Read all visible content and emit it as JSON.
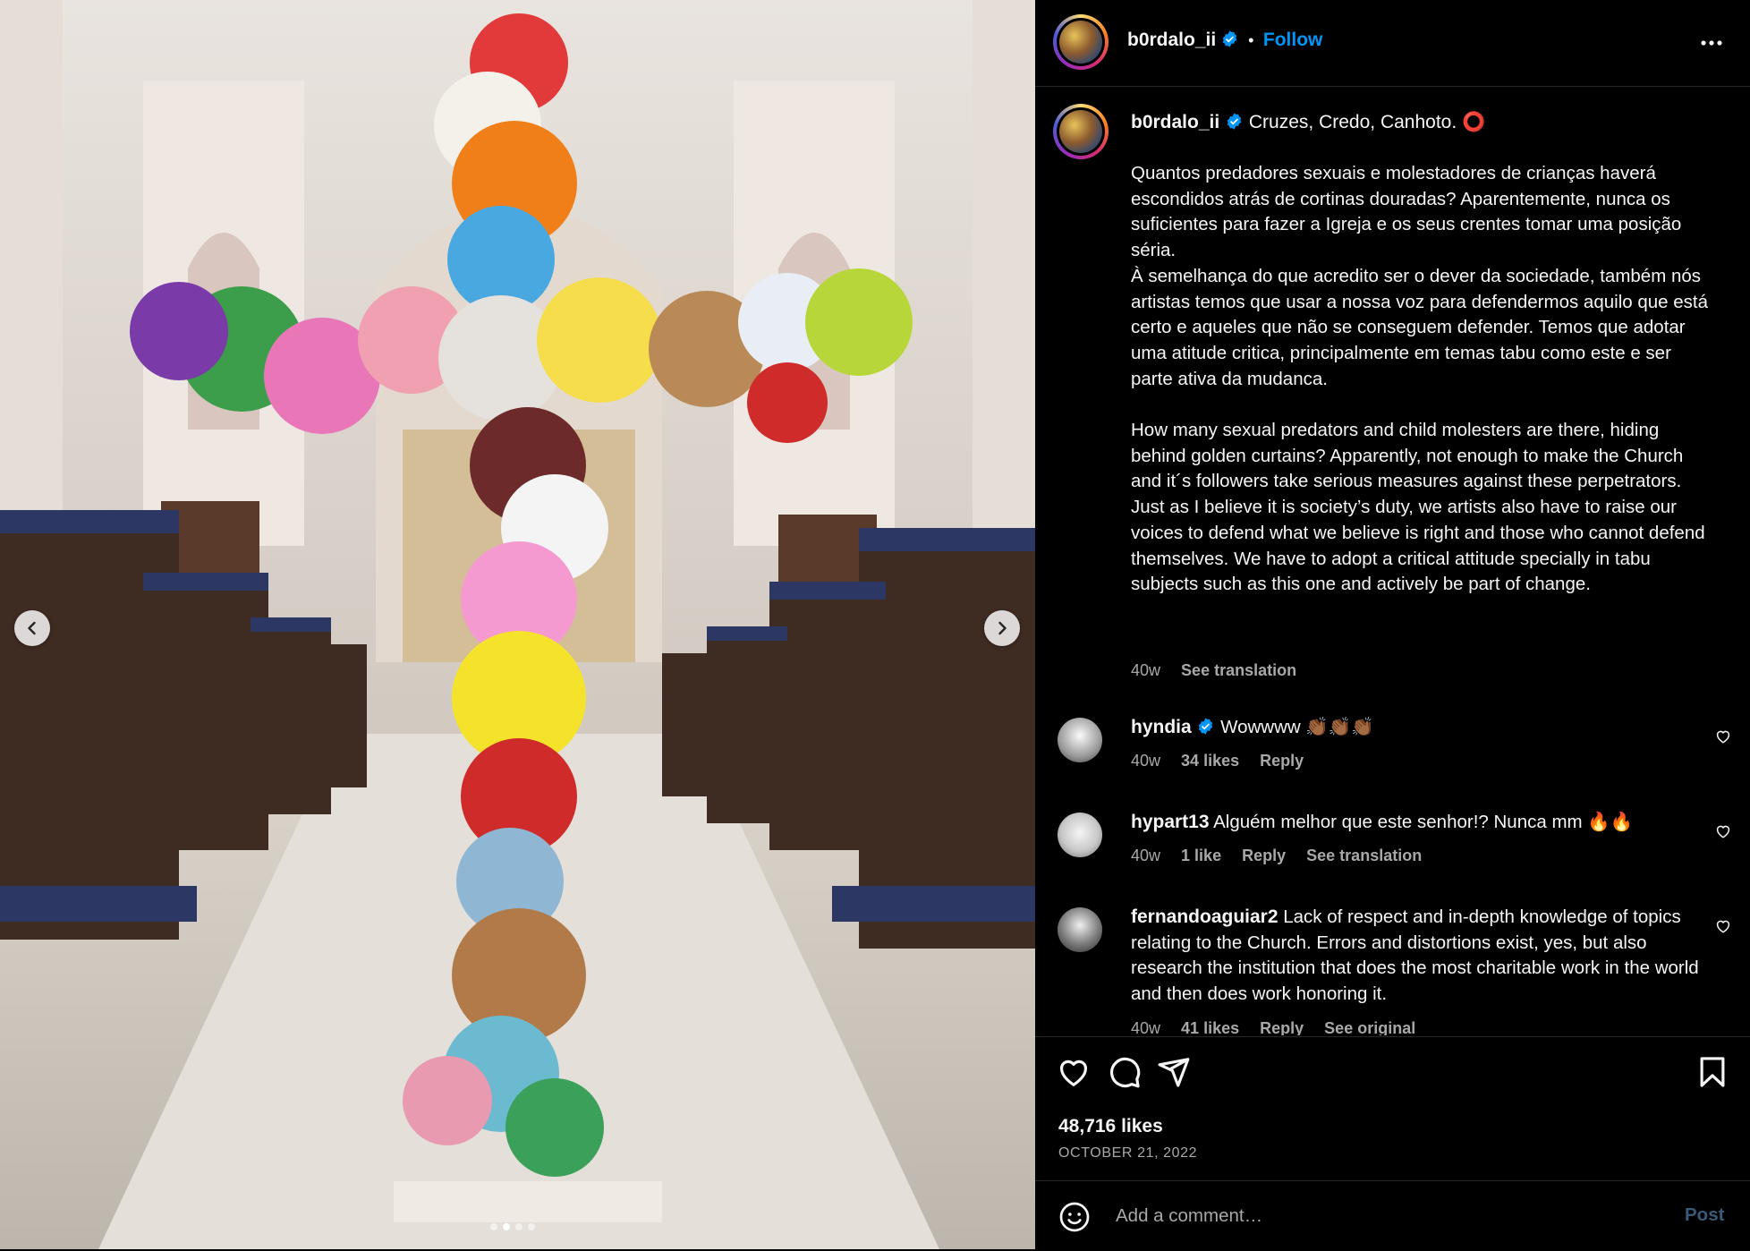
{
  "post": {
    "username": "b0rdalo_ii",
    "follow_label": "Follow",
    "separator": "•",
    "caption_title": "Cruzes, Credo, Canhoto. ⭕",
    "caption_body": "Quantos predadores sexuais e molestadores de crianças haverá escondidos atrás de cortinas douradas? Aparentemente, nunca os suficientes para fazer a Igreja e os seus crentes tomar uma posição séria.\nÀ semelhança do que acredito ser o dever da sociedade, também nós artistas temos que usar a nossa voz para defendermos aquilo que está certo e aqueles que não se conseguem defender. Temos que adotar uma atitude critica, principalmente em temas tabu como este e ser parte ativa da mudanca.\n\nHow many sexual predators and child molesters are there, hiding behind golden curtains? Apparently, not enough to make the Church and it´s followers take serious measures against these perpetrators. Just as I believe it is society’s duty, we artists also have to raise our voices to defend what we believe is right and those who cannot defend themselves. We have to adopt a critical attitude specially in tabu subjects such as this one and actively be part of change.",
    "caption_age": "40w",
    "see_translation": "See translation",
    "likes": "48,716 likes",
    "date": "OCTOBER 21, 2022"
  },
  "comments": [
    {
      "user": "hyndia",
      "verified": true,
      "text": "Wowwww 👏🏾👏🏾👏🏾",
      "age": "40w",
      "likes": "34 likes",
      "reply": "Reply",
      "extra": ""
    },
    {
      "user": "hypart13",
      "verified": false,
      "text": "Alguém melhor que este senhor!? Nunca mm 🔥🔥",
      "age": "40w",
      "likes": "1 like",
      "reply": "Reply",
      "extra": "See translation"
    },
    {
      "user": "fernandoaguiar2",
      "verified": false,
      "text": "Lack of respect and in-depth knowledge of topics relating to the Church. Errors and distortions exist, yes, but also research the institution that does the most charitable work in the world and then does work honoring it.",
      "age": "40w",
      "likes": "41 likes",
      "reply": "Reply",
      "extra": "See original"
    }
  ],
  "composer": {
    "placeholder": "Add a comment…",
    "post_label": "Post"
  },
  "carousel": {
    "count": 4,
    "active_index": 1
  },
  "icons": {
    "more": "more-horizontal-icon",
    "verified": "verified-badge-icon",
    "heart": "heart-icon",
    "comment": "comment-icon",
    "share": "share-icon",
    "save": "bookmark-icon",
    "emoji": "emoji-icon",
    "prev": "chevron-left-icon",
    "next": "chevron-right-icon"
  },
  "colors": {
    "link": "#0095f6",
    "verified": "#0095f6",
    "secondary": "#a8a8a8",
    "divider": "#262626"
  }
}
